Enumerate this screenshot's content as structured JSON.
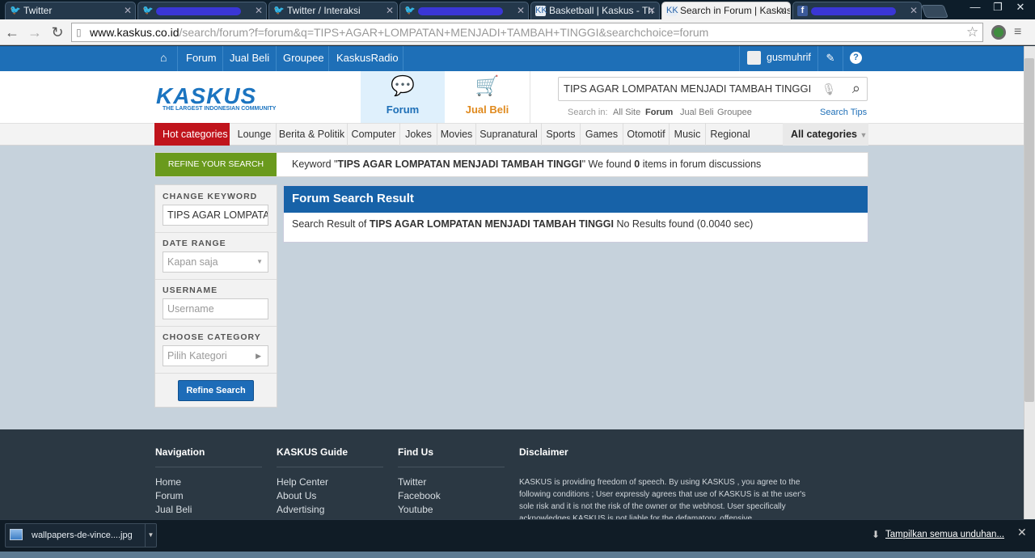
{
  "browser": {
    "tabs": [
      {
        "title": "Twitter",
        "icon": "twitter-icon",
        "active": false
      },
      {
        "title": "",
        "icon": "twitter-icon",
        "active": false,
        "redacted": true
      },
      {
        "title": "Twitter / Interaksi",
        "icon": "twitter-icon",
        "active": false
      },
      {
        "title": "",
        "icon": "twitter-icon",
        "active": false,
        "redacted": true
      },
      {
        "title": "Basketball | Kaskus - Th",
        "icon": "kaskus-icon",
        "active": false
      },
      {
        "title": "Search in Forum | Kaskus",
        "icon": "kaskus-icon",
        "active": true
      },
      {
        "title": "",
        "icon": "facebook-icon",
        "active": false,
        "redacted": true
      }
    ],
    "url_host": "www.kaskus.co.id",
    "url_path": "/search/forum?f=forum&q=TIPS+AGAR+LOMPATAN+MENJADI+TAMBAH+TINGGI&searchchoice=forum"
  },
  "topbar": {
    "nav": [
      "Forum",
      "Jual Beli",
      "Groupee",
      "KaskusRadio"
    ],
    "username": "gusmuhrif"
  },
  "header": {
    "logo": "KASKUS",
    "tagline": "THE LARGEST INDONESIAN COMMUNITY",
    "forum_tab": "Forum",
    "jualbeli_tab": "Jual Beli",
    "search_value": "TIPS AGAR LOMPATAN MENJADI TAMBAH TINGGI",
    "search_in_label": "Search in:",
    "search_options": [
      "All Site",
      "Forum",
      "Jual Beli",
      "Groupee"
    ],
    "search_tips": "Search Tips"
  },
  "categories": {
    "hot": "Hot categories",
    "items": [
      "Lounge",
      "Berita & Politik",
      "Computer",
      "Jokes",
      "Movies",
      "Supranatural",
      "Sports",
      "Games",
      "Otomotif",
      "Music",
      "Regional"
    ],
    "all": "All categories"
  },
  "refine": {
    "badge": "REFINE YOUR SEARCH",
    "keyword_prefix": "Keyword \"",
    "keyword": "TIPS AGAR LOMPATAN MENJADI TAMBAH TINGGI",
    "found_mid": "\" We found ",
    "count": "0",
    "found_suffix": " items in forum discussions"
  },
  "sidebar": {
    "change_keyword": "CHANGE KEYWORD",
    "keyword_value": "TIPS AGAR LOMPATAN MENJADI TAMBAH TINGGI",
    "date_range": "DATE RANGE",
    "date_value": "Kapan saja",
    "username": "USERNAME",
    "username_placeholder": "Username",
    "choose_category": "CHOOSE CATEGORY",
    "category_value": "Pilih Kategori",
    "refine_button": "Refine Search"
  },
  "result": {
    "title": "Forum Search Result",
    "prefix": "Search Result of ",
    "keyword": "TIPS AGAR LOMPATAN MENJADI TAMBAH TINGGI",
    "suffix": " No Results found (0.0040 sec)"
  },
  "footer": {
    "navigation": {
      "title": "Navigation",
      "links": [
        "Home",
        "Forum",
        "Jual Beli"
      ]
    },
    "guide": {
      "title": "KASKUS Guide",
      "links": [
        "Help Center",
        "About Us",
        "Advertising"
      ]
    },
    "findus": {
      "title": "Find Us",
      "links": [
        "Twitter",
        "Facebook",
        "Youtube"
      ]
    },
    "disclaimer": {
      "title": "Disclaimer",
      "text": "KASKUS is providing freedom of speech. By using KASKUS , you agree to the following conditions ; User expressly agrees that use of KASKUS is at the user's sole risk and it is not the risk of the owner or the webhost. User specifically acknowledges KASKUS is not liable for the defamatory, offensive"
    }
  },
  "downloads": {
    "file": "wallpapers-de-vince....jpg",
    "show_all": "Tampilkan semua unduhan..."
  }
}
